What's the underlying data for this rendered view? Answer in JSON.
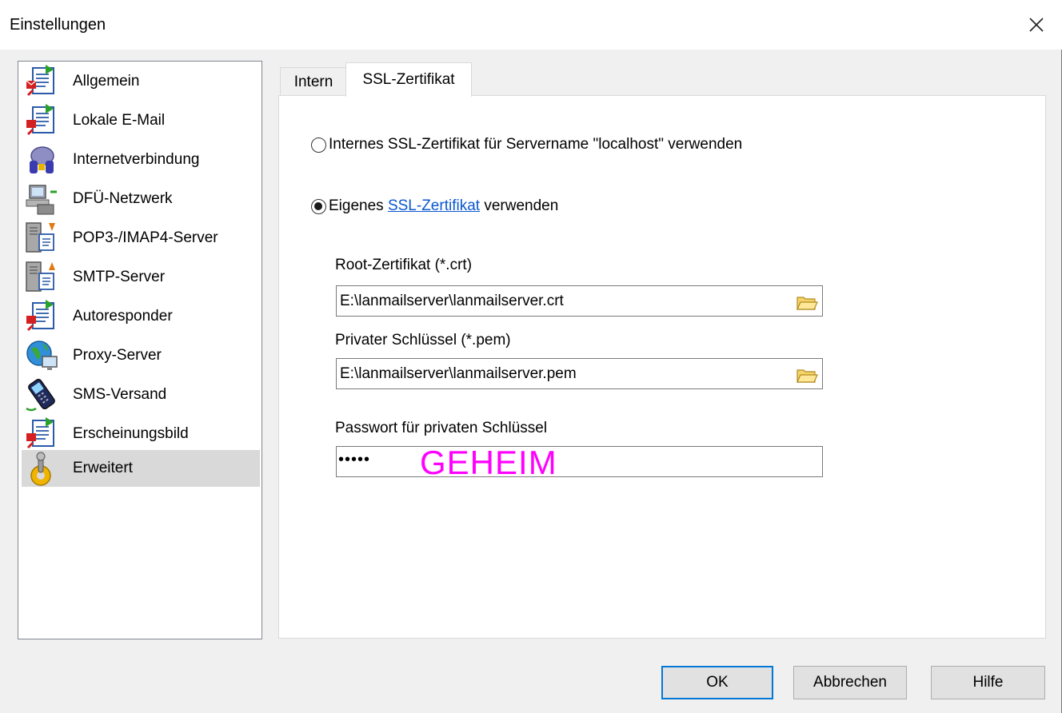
{
  "window": {
    "title": "Einstellungen"
  },
  "sidebar": {
    "items": [
      {
        "label": "Allgemein",
        "icon": "mail-document-icon"
      },
      {
        "label": "Lokale E-Mail",
        "icon": "mail-document-icon"
      },
      {
        "label": "Internetverbindung",
        "icon": "connector-plug-icon"
      },
      {
        "label": "DFÜ-Netzwerk",
        "icon": "network-computer-icon"
      },
      {
        "label": "POP3-/IMAP4-Server",
        "icon": "server-download-icon"
      },
      {
        "label": "SMTP-Server",
        "icon": "server-upload-icon"
      },
      {
        "label": "Autoresponder",
        "icon": "mail-document-icon"
      },
      {
        "label": "Proxy-Server",
        "icon": "globe-monitor-icon"
      },
      {
        "label": "SMS-Versand",
        "icon": "mobile-phone-icon"
      },
      {
        "label": "Erscheinungsbild",
        "icon": "mail-document-icon"
      },
      {
        "label": "Erweitert",
        "icon": "gear-joystick-icon"
      }
    ],
    "selected_index": 10
  },
  "tabs": [
    {
      "label": "Intern"
    },
    {
      "label": "SSL-Zertifikat"
    }
  ],
  "active_tab": "SSL-Zertifikat",
  "ssl": {
    "option_internal": "Internes SSL-Zertifikat für Servername \"localhost\" verwenden",
    "option_own_prefix": "Eigenes ",
    "option_own_link": "SSL-Zertifikat",
    "option_own_suffix": " verwenden",
    "selected_option": "own",
    "root_cert_label": "Root-Zertifikat (*.crt)",
    "root_cert_value": "E:\\lanmailserver\\lanmailserver.crt",
    "private_key_label": "Privater Schlüssel (*.pem)",
    "private_key_value": "E:\\lanmailserver\\lanmailserver.pem",
    "password_label": "Passwort für privaten Schlüssel",
    "password_masked": "•••••",
    "password_annotation": "GEHEIM"
  },
  "buttons": {
    "ok": "OK",
    "cancel": "Abbrechen",
    "help": "Hilfe"
  },
  "colors": {
    "link": "#0b57d0",
    "annotation": "#ff00ff",
    "default_button_border": "#0078d7"
  }
}
